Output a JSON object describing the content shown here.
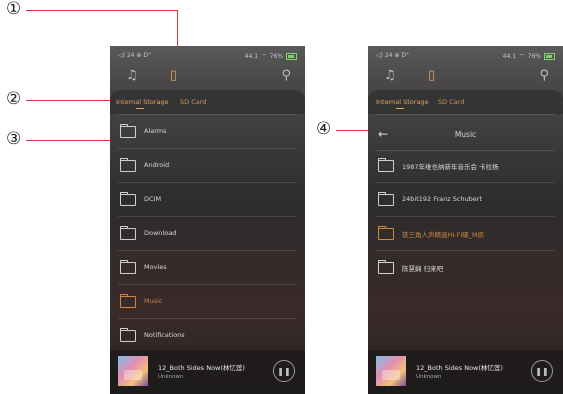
{
  "callouts": [
    "①",
    "②",
    "③",
    "④"
  ],
  "left_phone": {
    "status_left": "◁) 24 ⊕ D°",
    "status_wifi": "44.1",
    "status_battery": "76%",
    "music_icon": "music-note-icon",
    "folder_icon": "file-icon",
    "search_icon": "search-icon",
    "tabs": [
      "Internal Storage",
      "SD Card"
    ],
    "folders": [
      {
        "label": "Alarms",
        "accent": false
      },
      {
        "label": "Android",
        "accent": false
      },
      {
        "label": "DCIM",
        "accent": false
      },
      {
        "label": "Download",
        "accent": false
      },
      {
        "label": "Movies",
        "accent": false
      },
      {
        "label": "Music",
        "accent": true
      },
      {
        "label": "Notifications",
        "accent": false
      }
    ],
    "player": {
      "track": "12_Both Sides Now(林忆莲)",
      "artist": "Unknown"
    }
  },
  "right_phone": {
    "status_left": "◁) 24 ⊕ D°",
    "status_wifi": "44.1",
    "status_battery": "76%",
    "tabs": [
      "Internal Storage",
      "SD Card"
    ],
    "folder_title": "Music",
    "folders": [
      {
        "label": "1987年维也纳新年音乐会 卡拉扬",
        "accent": false
      },
      {
        "label": "24bit192 Franz Schubert",
        "accent": false
      },
      {
        "label": "铁三角人声精选HI-FI碟_M抓",
        "accent": true
      },
      {
        "label": "陈慧娴 归来吧",
        "accent": false
      }
    ],
    "player": {
      "track": "12_Both Sides Now(林忆莲)",
      "artist": "Unknown"
    }
  },
  "colors": {
    "accent": "#e2a45a",
    "callout_line": "#e0303a"
  }
}
